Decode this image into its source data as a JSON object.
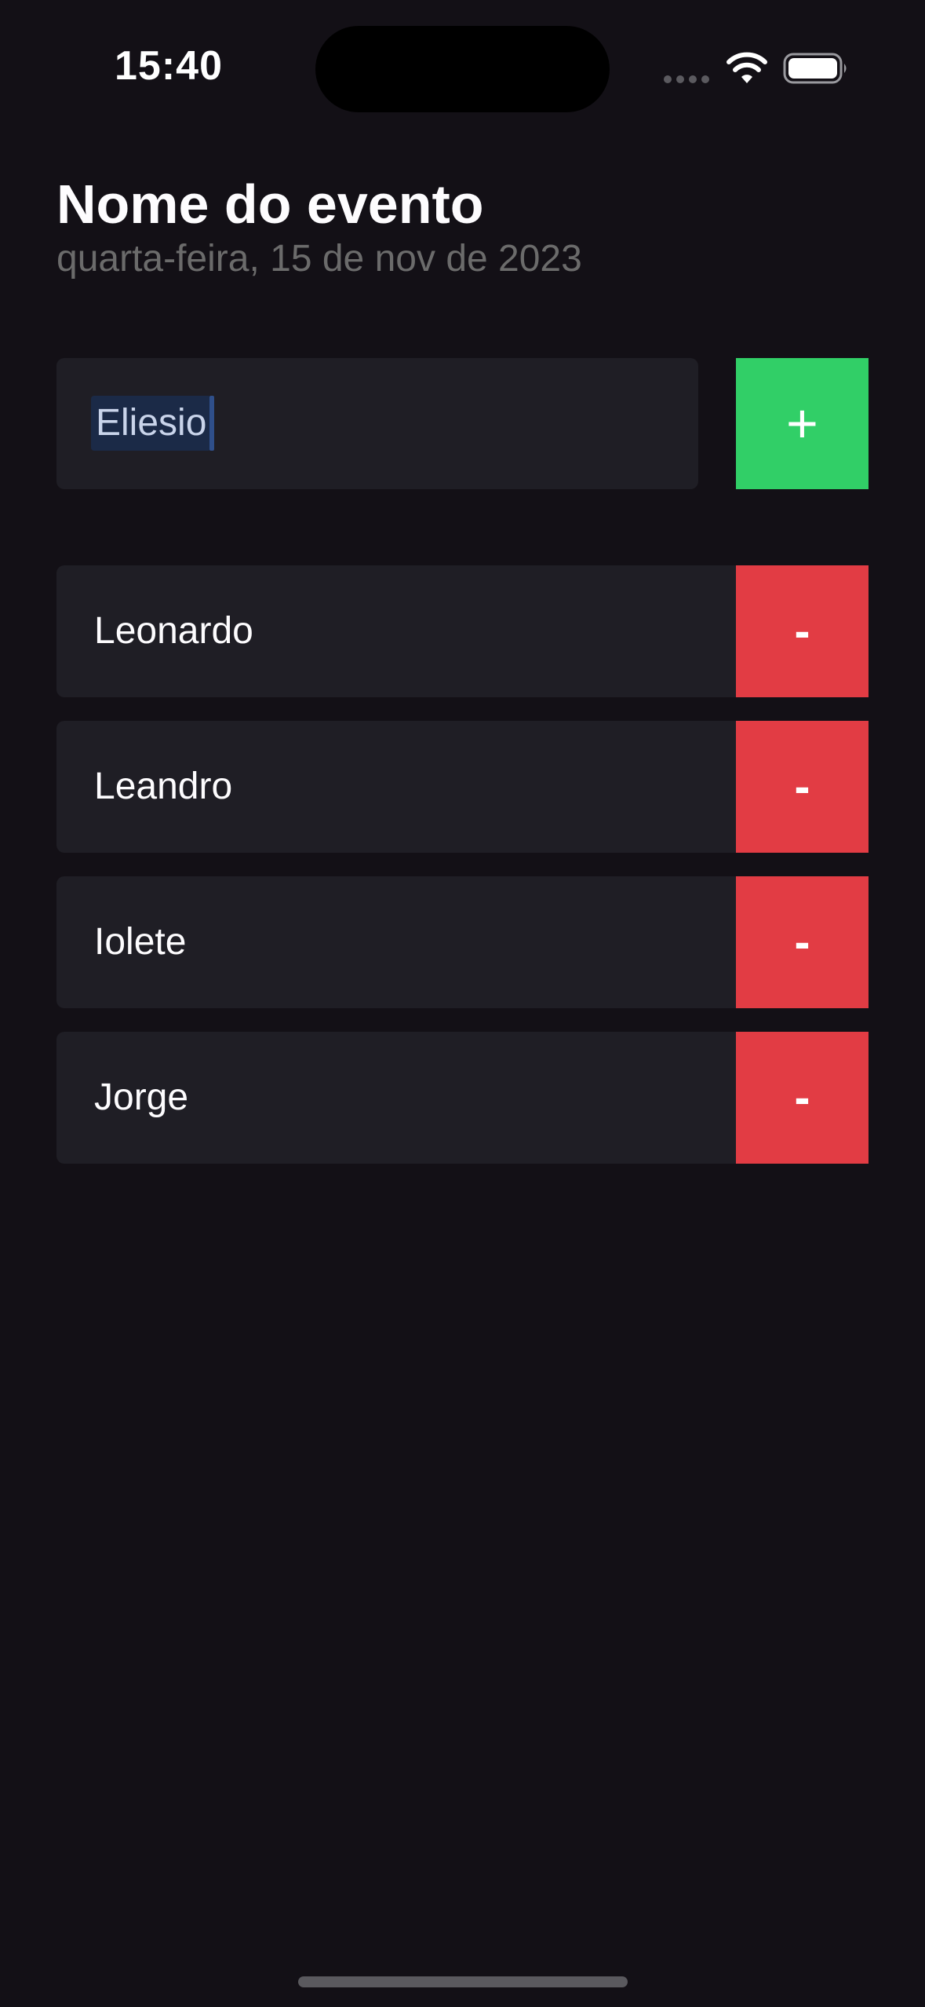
{
  "status_bar": {
    "time": "15:40"
  },
  "header": {
    "title": "Nome do evento",
    "subtitle": "quarta-feira, 15 de nov de 2023"
  },
  "input": {
    "value": "Eliesio",
    "add_label": "+"
  },
  "participants": [
    {
      "name": "Leonardo",
      "remove_label": "-"
    },
    {
      "name": "Leandro",
      "remove_label": "-"
    },
    {
      "name": "Iolete",
      "remove_label": "-"
    },
    {
      "name": "Jorge",
      "remove_label": "-"
    }
  ],
  "colors": {
    "background": "#131016",
    "card": "#1F1E25",
    "add_button": "#31CF67",
    "remove_button": "#E23C44",
    "subtitle": "#6B6B6B"
  }
}
